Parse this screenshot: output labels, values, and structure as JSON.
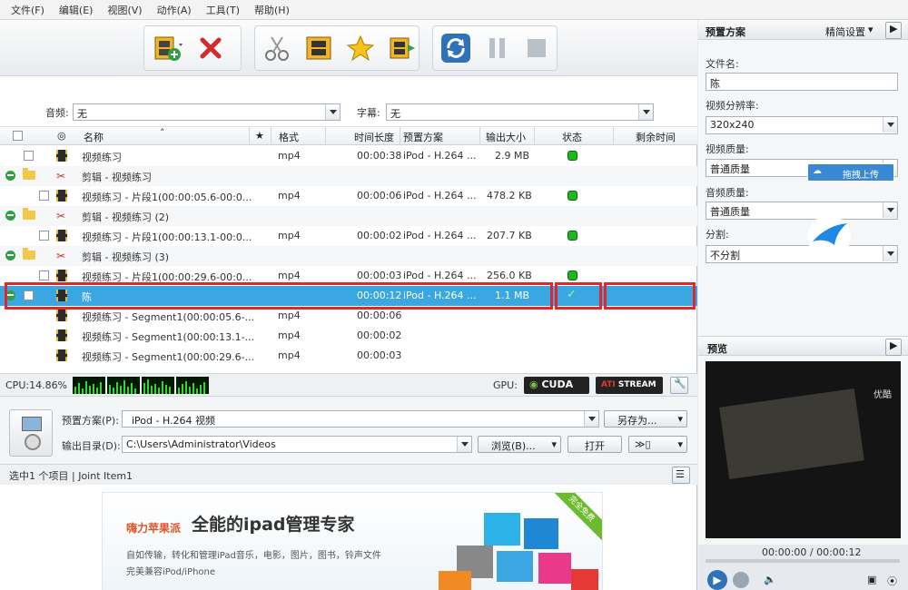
{
  "menu": [
    "文件(F)",
    "编辑(E)",
    "视图(V)",
    "动作(A)",
    "工具(T)",
    "帮助(H)"
  ],
  "toolbar": {
    "icons": [
      "add-video-icon",
      "delete-icon",
      "cut-icon",
      "film-icon",
      "star-icon",
      "merge-icon",
      "convert-icon",
      "pause-icon",
      "stop-icon"
    ]
  },
  "audio": {
    "label": "音频:",
    "value": "无"
  },
  "subtitle": {
    "label": "字幕:",
    "value": "无"
  },
  "columns": {
    "name": "名称",
    "star": "★",
    "format": "格式",
    "duration": "时间长度",
    "preset": "预置方案",
    "size": "输出大小",
    "status": "状态",
    "remaining": "剩余时间"
  },
  "rows": [
    {
      "kind": "file",
      "name": "视频练习",
      "format": "mp4",
      "duration": "00:00:38",
      "preset": "iPod - H.264 ...",
      "size": "2.9 MB",
      "status": "done"
    },
    {
      "kind": "group",
      "name": "剪辑 - 视频练习"
    },
    {
      "kind": "clip",
      "name": "视频练习 - 片段1(00:00:05.6-00:0...",
      "format": "mp4",
      "duration": "00:00:06",
      "preset": "iPod - H.264 ...",
      "size": "478.2 KB",
      "status": "done"
    },
    {
      "kind": "group",
      "name": "剪辑 - 视频练习 (2)"
    },
    {
      "kind": "clip",
      "name": "视频练习 - 片段1(00:00:13.1-00:0...",
      "format": "mp4",
      "duration": "00:00:02",
      "preset": "iPod - H.264 ...",
      "size": "207.7 KB",
      "status": "done"
    },
    {
      "kind": "group",
      "name": "剪辑 - 视频练习 (3)"
    },
    {
      "kind": "clip",
      "name": "视频练习 - 片段1(00:00:29.6-00:0...",
      "format": "mp4",
      "duration": "00:00:03",
      "preset": "iPod - H.264 ...",
      "size": "256.0 KB",
      "status": "done"
    },
    {
      "kind": "merged",
      "name": "陈",
      "format": "",
      "duration": "00:00:12",
      "preset": "iPod - H.264 ...",
      "size": "1.1 MB",
      "status": "check"
    },
    {
      "kind": "sub",
      "name": "视频练习 - Segment1(00:00:05.6-...",
      "format": "mp4",
      "duration": "00:00:06"
    },
    {
      "kind": "sub",
      "name": "视频练习 - Segment1(00:00:13.1-...",
      "format": "mp4",
      "duration": "00:00:02"
    },
    {
      "kind": "sub",
      "name": "视频练习 - Segment1(00:00:29.6-...",
      "format": "mp4",
      "duration": "00:00:03"
    }
  ],
  "cpu": {
    "label": "CPU:14.86%"
  },
  "gpu": {
    "label": "GPU:",
    "cuda": "CUDA",
    "ati": "STREAM"
  },
  "output": {
    "preset_label": "预置方案(P):",
    "preset_value": "iPod - H.264 视频",
    "saveas": "另存为...",
    "dir_label": "输出目录(D):",
    "dir_value": "C:\\Users\\Administrator\\Videos",
    "browse": "浏览(B)...",
    "open": "打开"
  },
  "statusbar": "选中1 个项目 | Joint Item1",
  "ad": {
    "brand": "嗨力苹果派",
    "headline": "全能的ipad管理专家",
    "line1": "自如传输，转化和管理iPad音乐，电影，图片，图书，铃声文件",
    "line2": "完美兼容iPod/iPhone",
    "ribbon": "完全免费"
  },
  "right": {
    "panel_title": "预置方案",
    "simple_settings": "精简设置",
    "filename_label": "文件名:",
    "filename_value": "陈",
    "resolution_label": "视频分辨率:",
    "resolution_value": "320x240",
    "vquality_label": "视频质量:",
    "vquality_value": "普通质量",
    "upload": "拖拽上传",
    "aquality_label": "音频质量:",
    "aquality_value": "普通质量",
    "split_label": "分割:",
    "split_value": "不分割",
    "preview_title": "预览",
    "preview_caption": "优酷",
    "time": "00:00:00 / 00:00:12"
  },
  "colors": {
    "accent": "#3aa6e2",
    "highlight": "#e0262e",
    "ok": "#1eb81e"
  }
}
